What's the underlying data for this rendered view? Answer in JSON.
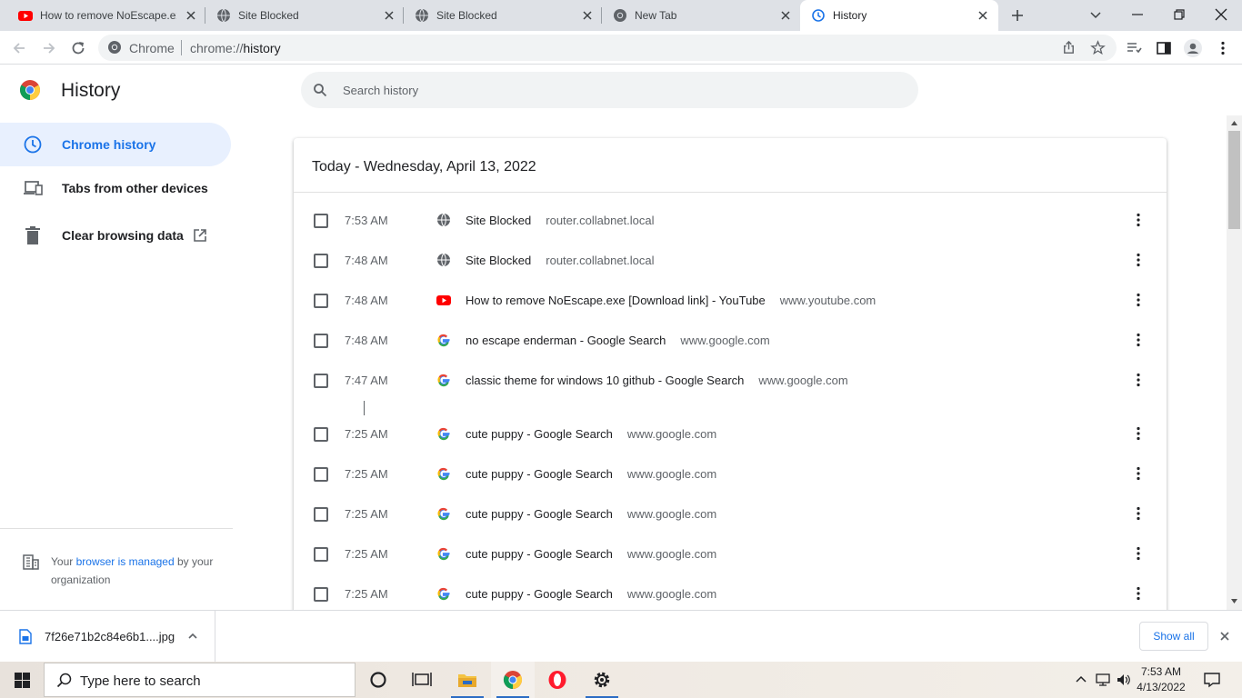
{
  "tabs": [
    {
      "title": "How to remove NoEscape.exe",
      "favicon": "youtube-icon"
    },
    {
      "title": "Site Blocked",
      "favicon": "globe-icon"
    },
    {
      "title": "Site Blocked",
      "favicon": "globe-icon"
    },
    {
      "title": "New Tab",
      "favicon": "chrome-icon"
    },
    {
      "title": "History",
      "favicon": "history-icon",
      "active": true
    }
  ],
  "omnibox": {
    "site_label": "Chrome",
    "url_prefix": "chrome://",
    "url_path": "history"
  },
  "page": {
    "title": "History",
    "search_placeholder": "Search history"
  },
  "sidebar": {
    "items": [
      {
        "label": "Chrome history",
        "icon": "clock-icon",
        "active": true
      },
      {
        "label": "Tabs from other devices",
        "icon": "devices-icon"
      },
      {
        "label": "Clear browsing data",
        "icon": "trash-icon"
      }
    ],
    "managed": {
      "prefix": "Your ",
      "link": "browser is managed",
      "suffix": " by your organization"
    }
  },
  "history": {
    "date_header": "Today - Wednesday, April 13, 2022",
    "entries": [
      {
        "time": "7:53 AM",
        "title": "Site Blocked",
        "domain": "router.collabnet.local",
        "favicon": "globe-icon"
      },
      {
        "time": "7:48 AM",
        "title": "Site Blocked",
        "domain": "router.collabnet.local",
        "favicon": "globe-icon"
      },
      {
        "time": "7:48 AM",
        "title": "How to remove NoEscape.exe [Download link] - YouTube",
        "domain": "www.youtube.com",
        "favicon": "youtube-icon"
      },
      {
        "time": "7:48 AM",
        "title": "no escape enderman - Google Search",
        "domain": "www.google.com",
        "favicon": "google-icon"
      },
      {
        "time": "7:47 AM",
        "title": "classic theme for windows 10 github - Google Search",
        "domain": "www.google.com",
        "favicon": "google-icon"
      },
      {
        "time": "7:25 AM",
        "title": "cute puppy - Google Search",
        "domain": "www.google.com",
        "favicon": "google-icon"
      },
      {
        "time": "7:25 AM",
        "title": "cute puppy - Google Search",
        "domain": "www.google.com",
        "favicon": "google-icon"
      },
      {
        "time": "7:25 AM",
        "title": "cute puppy - Google Search",
        "domain": "www.google.com",
        "favicon": "google-icon"
      },
      {
        "time": "7:25 AM",
        "title": "cute puppy - Google Search",
        "domain": "www.google.com",
        "favicon": "google-icon"
      },
      {
        "time": "7:25 AM",
        "title": "cute puppy - Google Search",
        "domain": "www.google.com",
        "favicon": "google-icon"
      }
    ]
  },
  "downloads": {
    "filename": "7f26e71b2c84e6b1....jpg",
    "show_all": "Show all"
  },
  "taskbar": {
    "search_placeholder": "Type here to search",
    "time": "7:53 AM",
    "date": "4/13/2022"
  },
  "colors": {
    "accent": "#1a73e8",
    "active_nav_bg": "#e8f0fe",
    "tabstrip": "#dee1e6"
  }
}
